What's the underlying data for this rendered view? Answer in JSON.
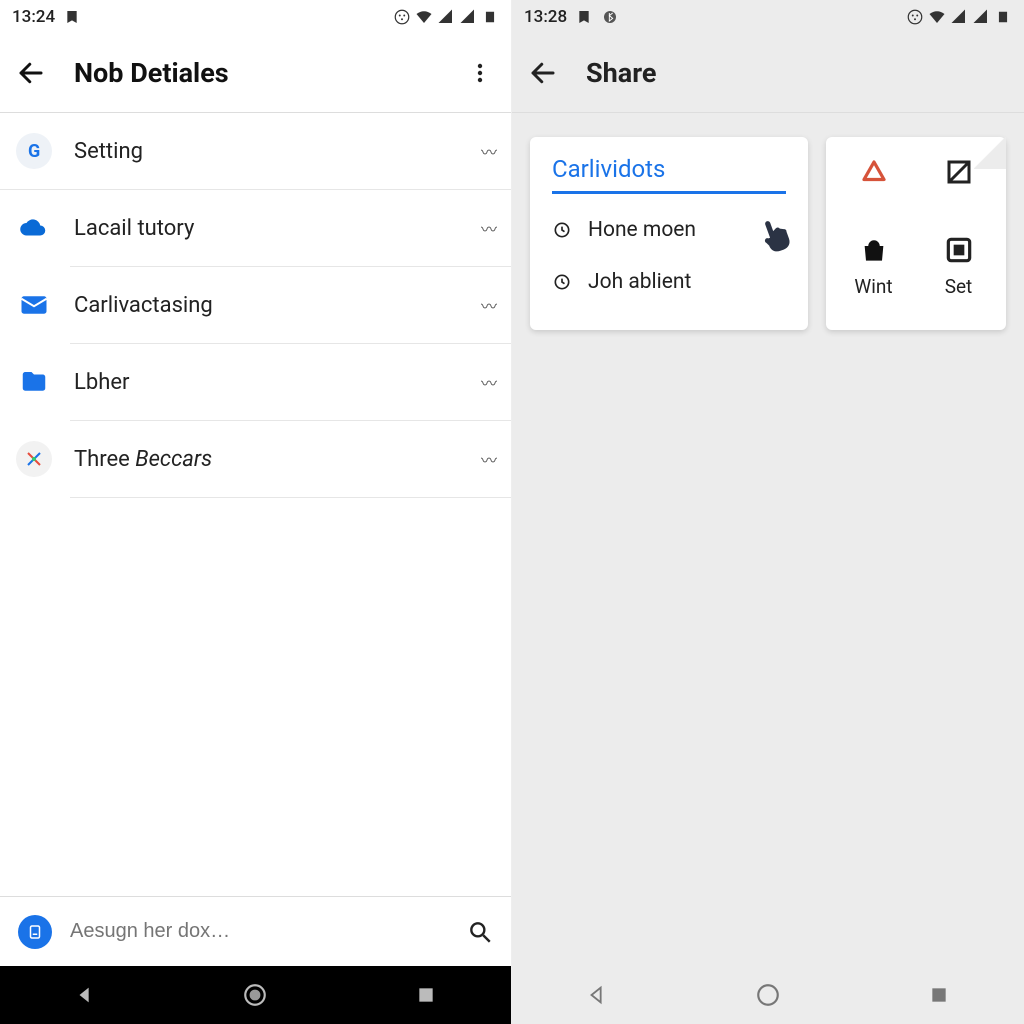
{
  "left": {
    "status": {
      "time": "13:24"
    },
    "header": {
      "title": "Nob Detiales"
    },
    "items": [
      {
        "label": "Setting",
        "icon": "g-icon"
      },
      {
        "label": "Lacail tutory",
        "icon": "cloud-icon"
      },
      {
        "label": "Carlivactasing",
        "icon": "mail-icon"
      },
      {
        "label": "Lbher",
        "icon": "folder-icon"
      },
      {
        "label": "Three ",
        "label_italic": "Beccars",
        "icon": "tools-icon"
      }
    ],
    "search": {
      "placeholder": "Aesugn her dox…"
    }
  },
  "right": {
    "status": {
      "time": "13:28"
    },
    "header": {
      "title": "Share"
    },
    "card_main": {
      "title": "Carlividots",
      "rows": [
        {
          "label": "Hone moen"
        },
        {
          "label": "Joh ablient"
        }
      ]
    },
    "card_grid": {
      "cells": [
        {
          "label": "",
          "icon": "triangle-icon"
        },
        {
          "label": "",
          "icon": "crossbox-icon"
        },
        {
          "label": "Wint",
          "icon": "bag-icon"
        },
        {
          "label": "Set",
          "icon": "square-icon"
        }
      ]
    }
  }
}
